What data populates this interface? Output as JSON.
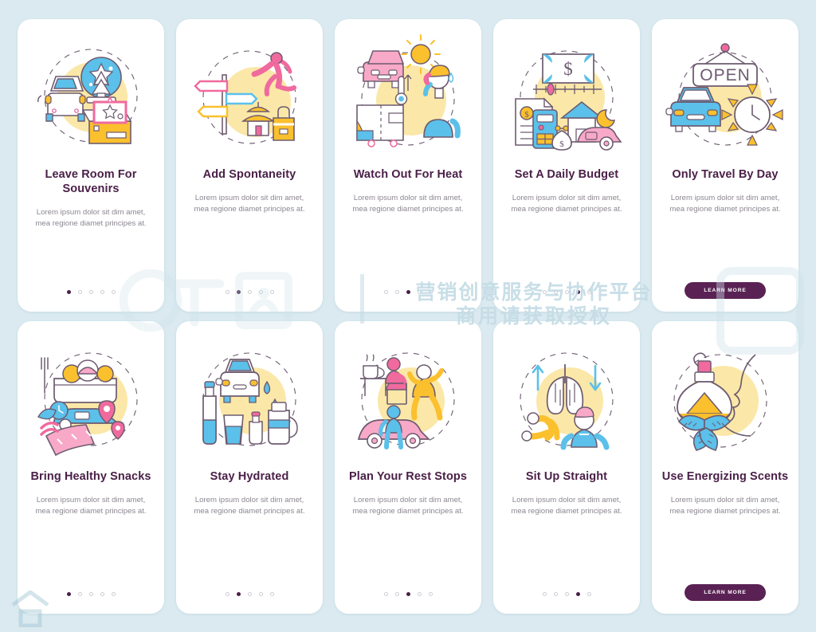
{
  "page": {
    "background_color": "#daeaf0",
    "card_background": "#ffffff",
    "title_color": "#4a2048",
    "body_color": "#8c8691",
    "accent_color": "#5a2254",
    "dot_active_color": "#4a2048",
    "dot_inactive_color": "#cfcbd4"
  },
  "watermark": {
    "brand": "千图",
    "line1": "营销创意服务与协作平台",
    "line2": "商用请获取授权"
  },
  "shared": {
    "body_text": "Lorem ipsum dolor sit dim amet, mea regione diamet principes at.",
    "learn_more_label": "LEARN MORE",
    "dot_count": 5
  },
  "rows": [
    {
      "cards": [
        {
          "title": "Leave Room For Souvenirs",
          "body": "Lorem ipsum dolor sit dim amet, mea regione diamet principes at.",
          "illustration": "car-trunk-snowglobe-souvenir-box-icon",
          "footer": "dots",
          "active_dot": 1
        },
        {
          "title": "Add Spontaneity",
          "body": "Lorem ipsum dolor sit dim amet, mea regione diamet principes at.",
          "illustration": "signpost-jumping-person-pagoda-bag-icon",
          "footer": "dots",
          "active_dot": 2
        },
        {
          "title": "Watch Out For Heat",
          "body": "Lorem ipsum dolor sit dim amet, mea regione diamet principes at.",
          "illustration": "sun-car-thermometer-map-sweating-person-icon",
          "footer": "dots",
          "active_dot": 3
        },
        {
          "title": "Set A Daily Budget",
          "body": "Lorem ipsum dolor sit dim amet, mea regione diamet principes at.",
          "illustration": "banknote-calculator-bill-house-moneybag-car-icon",
          "footer": "dots",
          "active_dot": 4
        },
        {
          "title": "Only Travel By Day",
          "body": "Lorem ipsum dolor sit dim amet, mea regione diamet principes at.",
          "illustration": "open-sign-car-clock-sun-icon",
          "footer": "button",
          "button_label": "LEARN MORE"
        }
      ]
    },
    {
      "cards": [
        {
          "title": "Bring Healthy Snacks",
          "body": "Lorem ipsum dolor sit dim amet, mea regione diamet principes at.",
          "illustration": "food-tray-car-map-pins-clock-icon",
          "footer": "dots",
          "active_dot": 1
        },
        {
          "title": "Stay Hydrated",
          "body": "Lorem ipsum dolor sit dim amet, mea regione diamet principes at.",
          "illustration": "water-bottle-car-glass-thermos-icon",
          "footer": "dots",
          "active_dot": 2
        },
        {
          "title": "Plan Your Rest Stops",
          "body": "Lorem ipsum dolor sit dim amet, mea regione diamet principes at.",
          "illustration": "car-resting-person-stretching-table-icon",
          "footer": "dots",
          "active_dot": 3
        },
        {
          "title": "Sit Up Straight",
          "body": "Lorem ipsum dolor sit dim amet, mea regione diamet principes at.",
          "illustration": "lungs-arrows-spine-seated-person-icon",
          "footer": "dots",
          "active_dot": 4
        },
        {
          "title": "Use Energizing Scents",
          "body": "Lorem ipsum dolor sit dim amet, mea regione diamet principes at.",
          "illustration": "essential-oil-bottle-mint-leaves-face-profile-icon",
          "footer": "button",
          "button_label": "LEARN MORE"
        }
      ]
    }
  ]
}
